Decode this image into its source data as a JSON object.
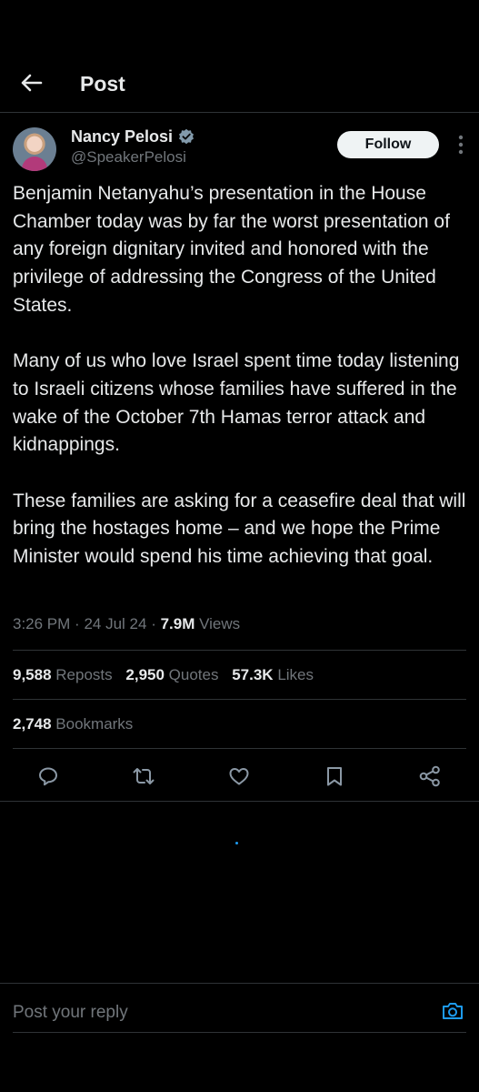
{
  "header": {
    "title": "Post"
  },
  "author": {
    "name": "Nancy Pelosi",
    "handle": "@SpeakerPelosi",
    "verified": true,
    "follow_label": "Follow"
  },
  "post": {
    "paragraphs": [
      "Benjamin Netanyahu’s presentation in the House Chamber today was by far the worst presentation of any foreign dignitary invited and honored with the privilege of addressing the Congress of the United States.",
      "Many of us who love Israel spent time today listening to Israeli citizens whose families have suffered in the wake of the October 7th Hamas terror attack and kidnappings.",
      "These families are asking for a ceasefire deal that will bring the hostages home – and we hope the Prime Minister would spend his time achieving that goal."
    ],
    "time": "3:26 PM",
    "date": "24 Jul 24",
    "separator": "·",
    "views_count": "7.9M",
    "views_label": "Views"
  },
  "stats": {
    "reposts_count": "9,588",
    "reposts_label": "Reposts",
    "quotes_count": "2,950",
    "quotes_label": "Quotes",
    "likes_count": "57.3K",
    "likes_label": "Likes",
    "bookmarks_count": "2,748",
    "bookmarks_label": "Bookmarks"
  },
  "actions": [
    "reply-icon",
    "repost-icon",
    "like-icon",
    "bookmark-icon",
    "share-icon"
  ],
  "reply": {
    "placeholder": "Post your reply"
  },
  "colors": {
    "background": "#000000",
    "text": "#e7e9ea",
    "muted": "#71767b",
    "accent": "#1d9bf0",
    "divider": "#2f3336"
  }
}
